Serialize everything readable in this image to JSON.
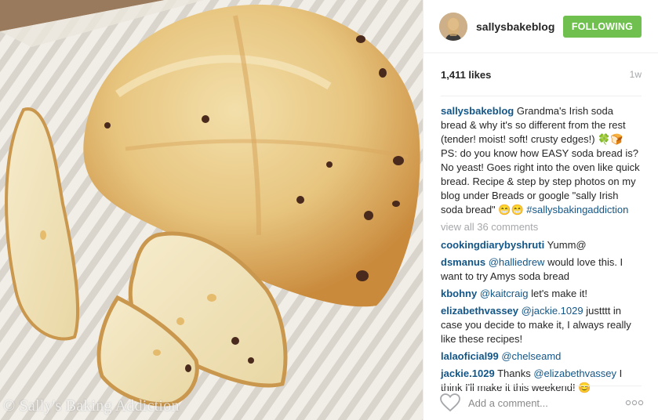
{
  "photo": {
    "alt_icon": "irish-soda-bread-photo",
    "watermark": "© Sally's Baking Addiction"
  },
  "header": {
    "username": "sallysbakeblog",
    "follow_label": "FOLLOWING",
    "follow_color": "#70c050"
  },
  "meta": {
    "likes": "1,411 likes",
    "time": "1w"
  },
  "caption": {
    "user": "sallysbakeblog",
    "text": "Grandma's Irish soda bread & why it's so different from the rest (tender! moist! soft! crusty edges!) 🍀🍞 PS: do you know how EASY soda bread is? No yeast! Goes right into the oven like quick bread. Recipe & step by step photos on my blog under Breads or google \"sally Irish soda bread\" 😁😁 ",
    "hashtag": "#sallysbakingaddiction"
  },
  "view_all": "view all 36 comments",
  "comments": [
    {
      "user": "cookingdiarybyshruti",
      "mention": "",
      "text": "Yumm@"
    },
    {
      "user": "dsmanus",
      "mention": "@halliedrew",
      "text": "would love this. I want to try Amys soda bread"
    },
    {
      "user": "kbohny",
      "mention": "@kaitcraig",
      "text": "let's make it!"
    },
    {
      "user": "elizabethvassey",
      "mention": "@jackie.1029",
      "text": "justttt in case you decide to make it, I always really like these recipes!"
    },
    {
      "user": "lalaoficial99",
      "mention": "@chelseamd",
      "text": ""
    },
    {
      "user": "jackie.1029",
      "mention": "@elizabethvassey",
      "text": "I think I'll make it this weekend! 😊",
      "prefix": "Thanks"
    }
  ],
  "footer": {
    "placeholder": "Add a comment...",
    "like_icon": "heart-outline-icon",
    "more_icon": "more-options-icon"
  }
}
